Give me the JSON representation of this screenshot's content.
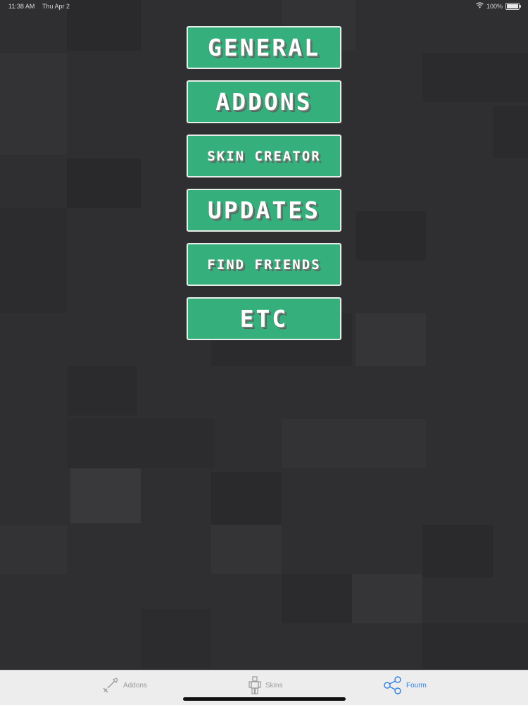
{
  "status_bar": {
    "time": "11:38 AM",
    "date": "Thu Apr 2",
    "battery": "100%"
  },
  "menu": [
    {
      "label": "GENERAL"
    },
    {
      "label": "ADDONS"
    },
    {
      "label": "SKIN CREATOR"
    },
    {
      "label": "UPDATES"
    },
    {
      "label": "FIND FRIENDS"
    },
    {
      "label": "ETC"
    }
  ],
  "tabs": [
    {
      "label": "Addons",
      "icon": "shovel-icon",
      "active": false
    },
    {
      "label": "Skins",
      "icon": "person-icon",
      "active": false
    },
    {
      "label": "Fourm",
      "icon": "share-icon",
      "active": true
    }
  ],
  "colors": {
    "button": "#35b07c",
    "background": "#2f2f31",
    "tab_active": "#2f7fe0",
    "tab_inactive": "#9a9a9a"
  }
}
